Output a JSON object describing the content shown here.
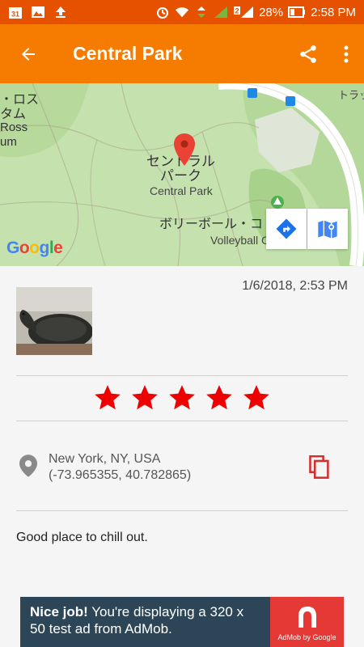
{
  "status_bar": {
    "notification_badge": "31",
    "signal_label": "2",
    "battery": "28%",
    "time": "2:58 PM"
  },
  "app_bar": {
    "title": "Central Park",
    "back_icon": "arrow-left-icon",
    "share_icon": "share-icon",
    "overflow_icon": "more-vert-icon"
  },
  "map": {
    "labels": {
      "museum_ja": "・ロス\nタム",
      "museum_en": "Ross\num",
      "park_ja": "セントラル\nパーク",
      "park_en": "Central Park",
      "volleyball_ja": "ボリーボール・コ",
      "volleyball_en": "Volleyball C",
      "corner_ja": "トラッ"
    },
    "google_letters": [
      "G",
      "o",
      "o",
      "g",
      "l",
      "e"
    ],
    "google_colors": [
      "#4285f4",
      "#ea4335",
      "#fbbc05",
      "#4285f4",
      "#34a853",
      "#ea4335"
    ],
    "directions_icon": "directions-icon",
    "open_maps_icon": "google-maps-icon"
  },
  "entry": {
    "timestamp": "1/6/2018, 2:53 PM",
    "rating": 5,
    "location_line1": "New York, NY, USA",
    "location_line2": "(-73.965355, 40.782865)",
    "note": "Good place to chill out.",
    "star_color": "#ee0000"
  },
  "ad": {
    "headline": "Nice job!",
    "body": " You're displaying a 320 x 50 test ad from AdMob.",
    "brand": "AdMob by Google"
  },
  "colors": {
    "status_bar": "#e65100",
    "app_bar": "#f57c00",
    "accent_red": "#d32f2f"
  }
}
